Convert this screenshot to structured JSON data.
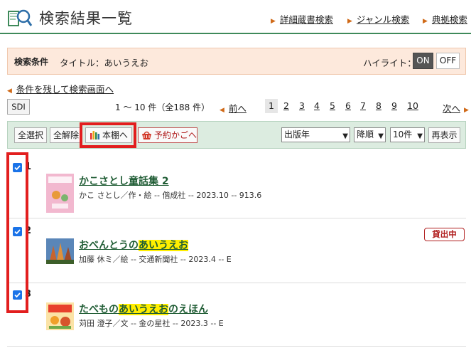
{
  "header": {
    "title": "検索結果一覧",
    "links": [
      "詳細蔵書検索",
      "ジャンル検索",
      "典拠検索"
    ]
  },
  "condition": {
    "label": "検索条件",
    "value": "タイトル：あいうえお",
    "highlight_label": "ハイライト：",
    "on_label": "ON",
    "off_label": "OFF"
  },
  "back_link": "条件を残して検索画面へ",
  "pagination": {
    "sdi_label": "SDI",
    "count_text": "1 ～ 10 件（全188 件）",
    "prev_label": "前へ",
    "next_label": "次へ",
    "current_page": 1,
    "pages": [
      "1",
      "2",
      "3",
      "4",
      "5",
      "6",
      "7",
      "8",
      "9",
      "10"
    ]
  },
  "toolbar": {
    "select_all": "全選択",
    "deselect_all": "全解除",
    "bookshelf": "本棚へ",
    "reserve_cart": "予約かごへ",
    "sort_field": "出版年",
    "sort_order": "降順",
    "per_page": "10件",
    "redisplay": "再表示"
  },
  "results": [
    {
      "num": "1",
      "checked": true,
      "title_pre": "かこさとし童話集 2",
      "title_hl": "",
      "title_post": "",
      "meta": "かこ さとし／作・絵 -- 偕成社 -- 2023.10 -- 913.6",
      "status": ""
    },
    {
      "num": "2",
      "checked": true,
      "title_pre": "おべんとうの",
      "title_hl": "あいうえお",
      "title_post": "",
      "meta": "加藤 休ミ／絵 -- 交通新聞社 -- 2023.4 -- E",
      "status": "貸出中"
    },
    {
      "num": "3",
      "checked": true,
      "title_pre": "たべもの",
      "title_hl": "あいうえお",
      "title_post": "のえほん",
      "meta": "苅田 澄子／文 -- 金の星社 -- 2023.3 -- E",
      "status": ""
    }
  ],
  "colors": {
    "accent_green": "#3e8a5a",
    "title_green": "#1f5c34",
    "condition_bg": "#fde9dc",
    "toolbar_bg": "#dcece0",
    "highlight_yellow": "#ffee00",
    "annotation_red": "#e21e1e",
    "loan_red": "#b01e1e",
    "arrow_orange": "#d06a18"
  }
}
